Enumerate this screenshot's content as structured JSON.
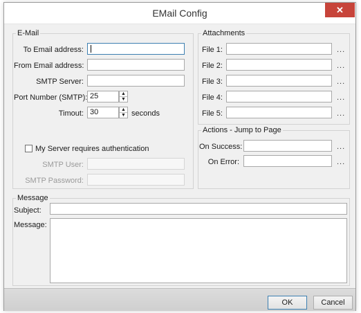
{
  "window": {
    "title": "EMail Config",
    "close_glyph": "✕"
  },
  "email": {
    "legend": "E-Mail",
    "to_label": "To Email address:",
    "to_value": "",
    "from_label": "From Email address:",
    "from_value": "",
    "smtp_server_label": "SMTP Server:",
    "smtp_server_value": "",
    "port_label": "Port Number (SMTP):",
    "port_value": "25",
    "timeout_label": "Timout:",
    "timeout_value": "30",
    "timeout_unit": "seconds",
    "auth_label": "My Server requires authentication",
    "auth_checked": false,
    "smtp_user_label": "SMTP User:",
    "smtp_user_value": "",
    "smtp_password_label": "SMTP Password:",
    "smtp_password_value": ""
  },
  "attachments": {
    "legend": "Attachments",
    "files": [
      {
        "label": "File 1:",
        "value": "",
        "browse": "..."
      },
      {
        "label": "File 2:",
        "value": "",
        "browse": "..."
      },
      {
        "label": "File 3:",
        "value": "",
        "browse": "..."
      },
      {
        "label": "File 4:",
        "value": "",
        "browse": "..."
      },
      {
        "label": "File 5:",
        "value": "",
        "browse": "..."
      }
    ]
  },
  "actions": {
    "legend": "Actions - Jump to Page",
    "success_label": "On Success:",
    "success_value": "",
    "success_browse": "...",
    "error_label": "On Error:",
    "error_value": "",
    "error_browse": "..."
  },
  "message": {
    "legend": "Message",
    "subject_label": "Subject:",
    "subject_value": "",
    "message_label": "Message:",
    "message_value": ""
  },
  "buttons": {
    "ok": "OK",
    "cancel": "Cancel"
  },
  "icons": {
    "close": "close-icon",
    "spin_up": "spin-up-icon",
    "spin_down": "spin-down-icon"
  },
  "colors": {
    "close_button": "#c7443a",
    "focus_border": "#3c7fb1",
    "dialog_bg": "#f0f0f0"
  }
}
